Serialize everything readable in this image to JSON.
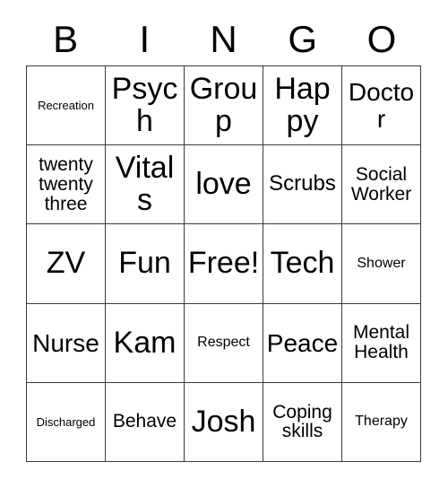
{
  "header": {
    "letters": [
      "B",
      "I",
      "N",
      "G",
      "O"
    ]
  },
  "grid": {
    "columns": 5,
    "rows": 5,
    "border_color": "#3a3a3a",
    "background_color": "#ffffff",
    "text_color": "#000000",
    "cells": [
      {
        "text": "Recreation",
        "size": "fs-xs"
      },
      {
        "text": "Psych",
        "size": "fs-xxl"
      },
      {
        "text": "Group",
        "size": "fs-xxl"
      },
      {
        "text": "Happy",
        "size": "fs-xxl"
      },
      {
        "text": "Doctor",
        "size": "fs-xl"
      },
      {
        "text": "twenty twenty three",
        "size": "fs-md"
      },
      {
        "text": "Vitals",
        "size": "fs-xxl"
      },
      {
        "text": "love",
        "size": "fs-xxl"
      },
      {
        "text": "Scrubs",
        "size": "fs-lg"
      },
      {
        "text": "Social Worker",
        "size": "fs-md"
      },
      {
        "text": "ZV",
        "size": "fs-xxl"
      },
      {
        "text": "Fun",
        "size": "fs-xxl"
      },
      {
        "text": "Free!",
        "size": "fs-xxl"
      },
      {
        "text": "Tech",
        "size": "fs-xxl"
      },
      {
        "text": "Shower",
        "size": "fs-sm"
      },
      {
        "text": "Nurse",
        "size": "fs-xl"
      },
      {
        "text": "Kam",
        "size": "fs-xxl"
      },
      {
        "text": "Respect",
        "size": "fs-sm"
      },
      {
        "text": "Peace",
        "size": "fs-xl"
      },
      {
        "text": "Mental Health",
        "size": "fs-md"
      },
      {
        "text": "Discharged",
        "size": "fs-xs"
      },
      {
        "text": "Behave",
        "size": "fs-md"
      },
      {
        "text": "Josh",
        "size": "fs-xxl"
      },
      {
        "text": "Coping skills",
        "size": "fs-md"
      },
      {
        "text": "Therapy",
        "size": "fs-sm"
      }
    ]
  }
}
